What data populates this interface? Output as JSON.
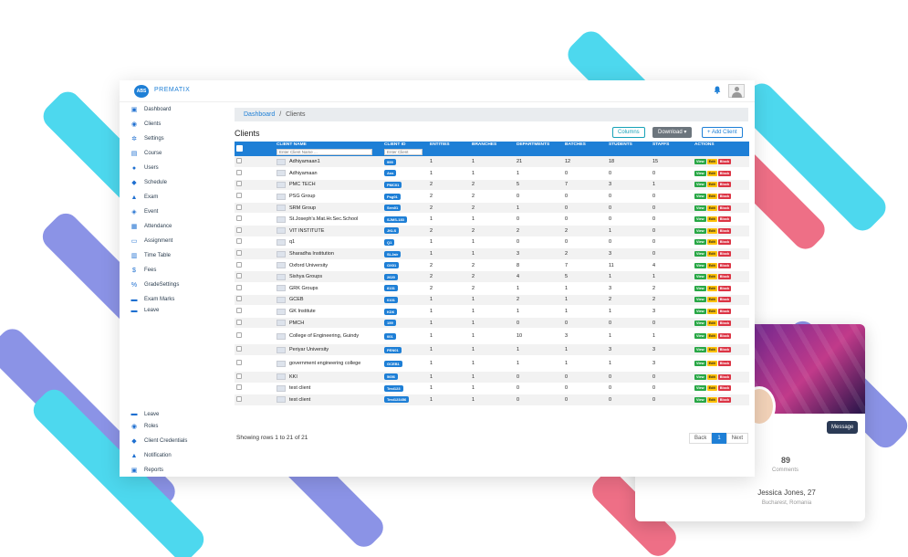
{
  "app": {
    "brand_text": "PREMATIX",
    "logo_text": "ABS"
  },
  "sidebar": {
    "items": [
      {
        "label": "Dashboard",
        "icon": "dashboard-icon",
        "glyph": "▣"
      },
      {
        "label": "Clients",
        "icon": "clients-icon",
        "glyph": "◉"
      },
      {
        "label": "Settings",
        "icon": "settings-icon",
        "glyph": "✲"
      },
      {
        "label": "Course",
        "icon": "course-icon",
        "glyph": "▤"
      },
      {
        "label": "Users",
        "icon": "users-icon",
        "glyph": "●"
      },
      {
        "label": "Schedule",
        "icon": "schedule-icon",
        "glyph": "◆"
      },
      {
        "label": "Exam",
        "icon": "exam-icon",
        "glyph": "▲"
      },
      {
        "label": "Event",
        "icon": "event-icon",
        "glyph": "◈"
      },
      {
        "label": "Attendance",
        "icon": "attendance-icon",
        "glyph": "▦"
      },
      {
        "label": "Assignment",
        "icon": "assignment-icon",
        "glyph": "▭"
      },
      {
        "label": "Time Table",
        "icon": "timetable-icon",
        "glyph": "▥"
      },
      {
        "label": "Fees",
        "icon": "fees-icon",
        "glyph": "$"
      },
      {
        "label": "GradeSettings",
        "icon": "grade-settings-icon",
        "glyph": "%"
      },
      {
        "label": "Exam Marks",
        "icon": "exam-marks-icon",
        "glyph": "▬"
      },
      {
        "label": "Leave",
        "icon": "leave-icon",
        "glyph": "▬"
      }
    ],
    "bottom_items": [
      {
        "label": "Leave",
        "icon": "leave-icon",
        "glyph": "▬"
      },
      {
        "label": "Roles",
        "icon": "roles-icon",
        "glyph": "◉"
      },
      {
        "label": "Client Credentials",
        "icon": "credentials-icon",
        "glyph": "◆"
      },
      {
        "label": "Notification",
        "icon": "notification-icon",
        "glyph": "▲"
      },
      {
        "label": "Reports",
        "icon": "reports-icon",
        "glyph": "▣"
      }
    ]
  },
  "breadcrumb": {
    "home": "Dashboard",
    "separator": "/",
    "current": "Clients"
  },
  "page": {
    "title": "Clients"
  },
  "toolbar": {
    "columns_label": "Columns",
    "download_label": "Download ▾",
    "add_label": "+ Add Client"
  },
  "table": {
    "columns": [
      "CLIENT NAME",
      "CLIENT ID",
      "ENTITIES",
      "BRANCHES",
      "DEPARTMENTS",
      "BATCHES",
      "STUDENTS",
      "STAFFS",
      "ACTIONS"
    ],
    "name_placeholder": "Enter Client Name ...",
    "id_placeholder": "Enter Client",
    "actions": {
      "view": "View",
      "edit": "Edit",
      "block": "Block"
    },
    "rows": [
      {
        "name": "Adhiyamaan1",
        "id": "999",
        "entities": "1",
        "branches": "1",
        "departments": "21",
        "batches": "12",
        "students": "18",
        "staffs": "15"
      },
      {
        "name": "Adhiyamaan",
        "id": "Ass",
        "entities": "1",
        "branches": "1",
        "departments": "1",
        "batches": "0",
        "students": "0",
        "staffs": "0"
      },
      {
        "name": "PMC TECH",
        "id": "PMC01",
        "entities": "2",
        "branches": "2",
        "departments": "5",
        "batches": "7",
        "students": "3",
        "staffs": "1"
      },
      {
        "name": "PSG Group",
        "id": "Psg01",
        "entities": "2",
        "branches": "2",
        "departments": "0",
        "batches": "0",
        "students": "0",
        "staffs": "0"
      },
      {
        "name": "SRM Group",
        "id": "Srm01",
        "entities": "2",
        "branches": "2",
        "departments": "1",
        "batches": "0",
        "students": "0",
        "staffs": "0"
      },
      {
        "name": "St.Joseph's.Mat.Hr.Sec.School",
        "id": "SJMS-183",
        "entities": "1",
        "branches": "1",
        "departments": "0",
        "batches": "0",
        "students": "0",
        "staffs": "0"
      },
      {
        "name": "VIT INSTITUTE",
        "id": "JKLS",
        "entities": "2",
        "branches": "2",
        "departments": "2",
        "batches": "2",
        "students": "1",
        "staffs": "0"
      },
      {
        "name": "q1",
        "id": "Q1",
        "entities": "1",
        "branches": "1",
        "departments": "0",
        "batches": "0",
        "students": "0",
        "staffs": "0"
      },
      {
        "name": "Sharadha Institution",
        "id": "SLJair",
        "entities": "1",
        "branches": "1",
        "departments": "3",
        "batches": "2",
        "students": "3",
        "staffs": "0"
      },
      {
        "name": "Oxford University",
        "id": "OX01",
        "entities": "2",
        "branches": "2",
        "departments": "8",
        "batches": "7",
        "students": "11",
        "staffs": "4"
      },
      {
        "name": "Sishya Groups",
        "id": "2620",
        "entities": "2",
        "branches": "2",
        "departments": "4",
        "batches": "5",
        "students": "1",
        "staffs": "1"
      },
      {
        "name": "GRK Groups",
        "id": "8131",
        "entities": "2",
        "branches": "2",
        "departments": "1",
        "batches": "1",
        "students": "3",
        "staffs": "2"
      },
      {
        "name": "GCEB",
        "id": "0101",
        "entities": "1",
        "branches": "1",
        "departments": "2",
        "batches": "1",
        "students": "2",
        "staffs": "2"
      },
      {
        "name": "GK Institute",
        "id": "KD6",
        "entities": "1",
        "branches": "1",
        "departments": "1",
        "batches": "1",
        "students": "1",
        "staffs": "3"
      },
      {
        "name": "PMCH",
        "id": "159",
        "entities": "1",
        "branches": "1",
        "departments": "0",
        "batches": "0",
        "students": "0",
        "staffs": "0"
      },
      {
        "name": "College of Engineering, Guindy",
        "id": "001",
        "entities": "1",
        "branches": "1",
        "departments": "10",
        "batches": "3",
        "students": "1",
        "staffs": "1"
      },
      {
        "name": "Periyar University",
        "id": "PEN01",
        "entities": "1",
        "branches": "1",
        "departments": "1",
        "batches": "1",
        "students": "3",
        "staffs": "3"
      },
      {
        "name": "government engineering college",
        "id": "GCEB1",
        "entities": "1",
        "branches": "1",
        "departments": "1",
        "batches": "1",
        "students": "1",
        "staffs": "3"
      },
      {
        "name": "KKI",
        "id": "5656",
        "entities": "1",
        "branches": "1",
        "departments": "0",
        "batches": "0",
        "students": "0",
        "staffs": "0"
      },
      {
        "name": "test client",
        "id": "Test123",
        "entities": "1",
        "branches": "1",
        "departments": "0",
        "batches": "0",
        "students": "0",
        "staffs": "0"
      },
      {
        "name": "test client",
        "id": "Test123456",
        "entities": "1",
        "branches": "1",
        "departments": "0",
        "batches": "0",
        "students": "0",
        "staffs": "0"
      }
    ]
  },
  "footer": {
    "summary": "Showing rows 1 to 21 of 21",
    "back": "Back",
    "page": "1",
    "next": "Next"
  },
  "profile_card": {
    "message_label": "Message",
    "count": "89",
    "count_label": "Comments",
    "name": "Jessica Jones, 27",
    "location": "Bucharest, Romania"
  },
  "colors": {
    "primary": "#1e7fd6",
    "cyan_stripe": "#4dd8ee",
    "purple_stripe": "#8b93e6",
    "pink_stripe": "#ee6f86",
    "view": "#28a745",
    "edit": "#ffc107",
    "block": "#dc3545"
  }
}
